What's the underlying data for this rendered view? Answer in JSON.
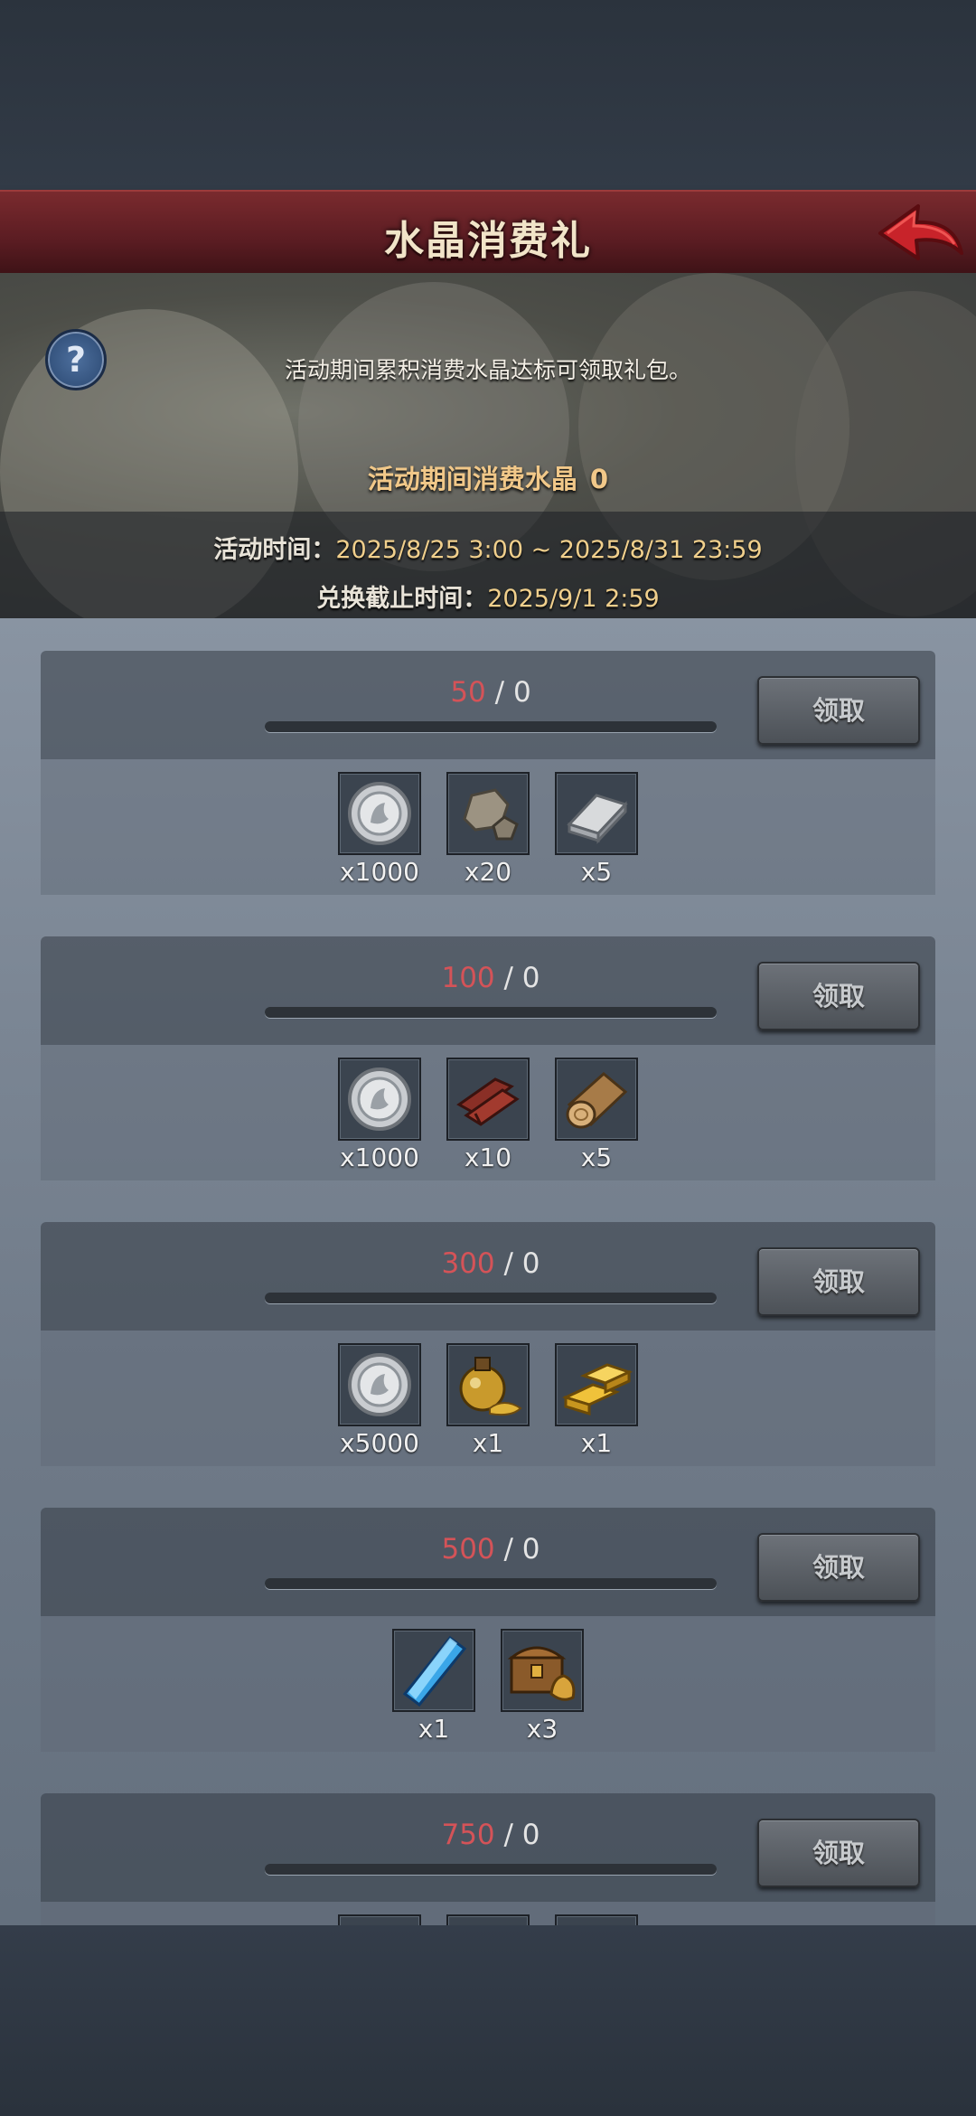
{
  "header": {
    "title": "水晶消费礼"
  },
  "banner": {
    "description": "活动期间累积消费水晶达标可领取礼包。",
    "spent_label": "活动期间消费水晶",
    "spent_value": "0",
    "time_label": "活动时间：",
    "time_value": "2025/8/25 3:00 ~ 2025/8/31 23:59",
    "deadline_label": "兑换截止时间：",
    "deadline_value": "2025/9/1 2:59"
  },
  "tiers": [
    {
      "need": "50",
      "sep": " / ",
      "current": "0",
      "button": "领取",
      "rewards": [
        {
          "icon": "silver-coin-icon",
          "qty": "x1000"
        },
        {
          "icon": "stone-icon",
          "qty": "x20"
        },
        {
          "icon": "iron-ingot-icon",
          "qty": "x5"
        }
      ]
    },
    {
      "need": "100",
      "sep": " / ",
      "current": "0",
      "button": "领取",
      "rewards": [
        {
          "icon": "silver-coin-icon",
          "qty": "x1000"
        },
        {
          "icon": "lumber-icon",
          "qty": "x10"
        },
        {
          "icon": "log-icon",
          "qty": "x5"
        }
      ]
    },
    {
      "need": "300",
      "sep": " / ",
      "current": "0",
      "button": "领取",
      "rewards": [
        {
          "icon": "silver-coin-icon",
          "qty": "x5000"
        },
        {
          "icon": "gold-potion-icon",
          "qty": "x1"
        },
        {
          "icon": "gold-bars-icon",
          "qty": "x1"
        }
      ]
    },
    {
      "need": "500",
      "sep": " / ",
      "current": "0",
      "button": "领取",
      "rewards": [
        {
          "icon": "blue-crystal-icon",
          "qty": "x1"
        },
        {
          "icon": "treasure-chest-icon",
          "qty": "x3"
        }
      ]
    },
    {
      "need": "750",
      "sep": " / ",
      "current": "0",
      "button": "领取",
      "rewards": [
        {
          "icon": "reward-icon",
          "qty": ""
        },
        {
          "icon": "reward-icon",
          "qty": ""
        },
        {
          "icon": "reward-icon",
          "qty": ""
        }
      ]
    }
  ]
}
